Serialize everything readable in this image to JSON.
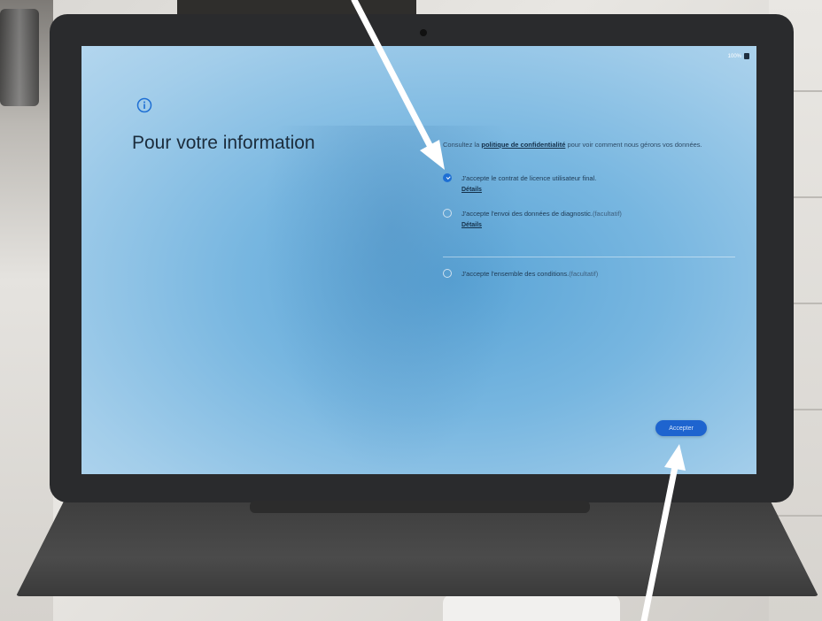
{
  "status_bar": {
    "battery_text": "100%"
  },
  "setup": {
    "info_icon": "info-circle-icon",
    "title": "Pour votre information",
    "privacy": {
      "prefix": "Consultez la ",
      "link": "politique de confidentialité",
      "suffix": " pour voir comment nous gérons vos données."
    },
    "options": [
      {
        "label": "J'accepte le contrat de licence utilisateur final.",
        "hint": "",
        "checked": true,
        "details": "Détails"
      },
      {
        "label": "J'accepte l'envoi des données de diagnostic.",
        "hint": " (facultatif)",
        "checked": false,
        "details": "Détails"
      },
      {
        "label": "J'accepte l'ensemble des conditions.",
        "hint": " (facultatif)",
        "checked": false,
        "details": ""
      }
    ],
    "accept_button": "Accepter"
  },
  "colors": {
    "screen_bg": "#77b6e0",
    "accent": "#1e6fd4",
    "title_text": "#1b2c3c",
    "arrow": "#ffffff"
  }
}
